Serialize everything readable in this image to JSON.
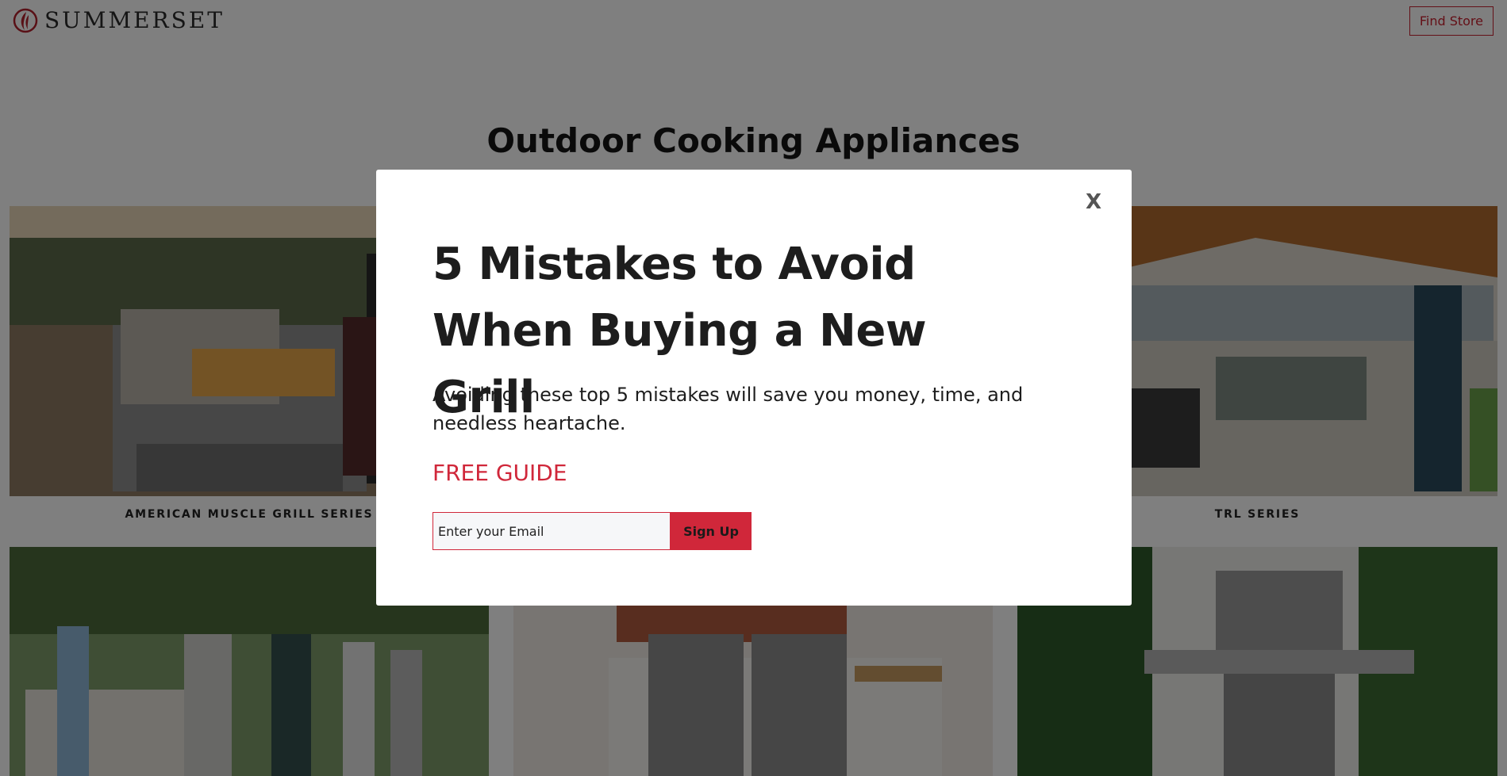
{
  "header": {
    "brand": "SUMMERSET",
    "find_store_label": "Find Store"
  },
  "page_title": "Outdoor Cooking Appliances",
  "products": [
    {
      "label": "AMERICAN MUSCLE GRILL SERIES"
    },
    {
      "label": "TRL SERIES"
    }
  ],
  "modal": {
    "close_label": "X",
    "title": "5 Mistakes to Avoid When Buying a New Grill",
    "body": "Avoiding these top 5 mistakes will save you money, time, and needless heartache.",
    "eyebrow": "FREE GUIDE",
    "email_placeholder": "Enter your Email",
    "signup_label": "Sign Up"
  },
  "colors": {
    "brand_red": "#d0273a",
    "overlay": "rgba(0,0,0,0.5)"
  }
}
